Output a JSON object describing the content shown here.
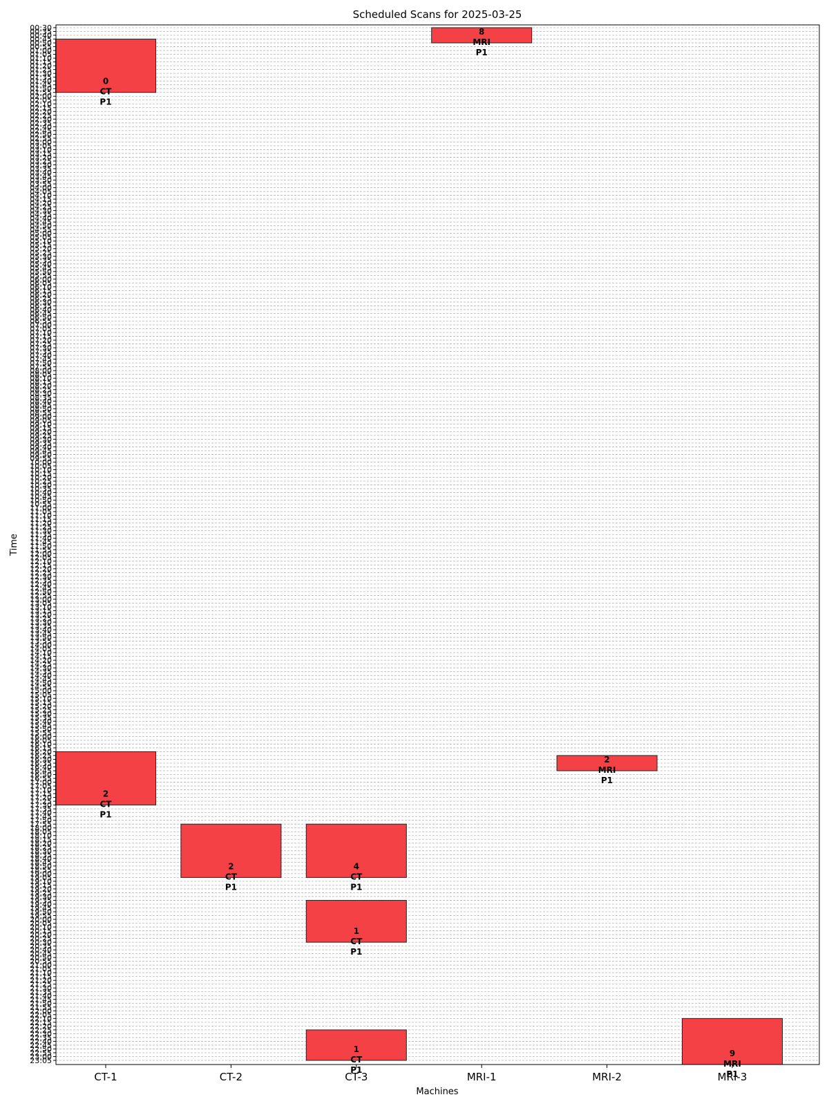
{
  "chart_data": {
    "type": "bar",
    "orientation": "gantt",
    "title": "Scheduled Scans for 2025-03-25",
    "xlabel": "Machines",
    "ylabel": "Time",
    "categories": [
      "CT-1",
      "CT-2",
      "CT-3",
      "MRI-1",
      "MRI-2",
      "MRI-3"
    ],
    "ylim": [
      "00:30",
      "23:05"
    ],
    "y_tick_step_minutes": 5,
    "y_inverted": true,
    "grid": "horizontal dashed",
    "bar_color": "#f44146",
    "scans": [
      {
        "machine": "CT-1",
        "start": "00:45",
        "end": "01:55",
        "label": [
          "0",
          "CT",
          "P1"
        ]
      },
      {
        "machine": "MRI-1",
        "start": "00:30",
        "end": "00:50",
        "label": [
          "8",
          "MRI",
          "P1"
        ]
      },
      {
        "machine": "CT-1",
        "start": "16:20",
        "end": "17:30",
        "label": [
          "2",
          "CT",
          "P1"
        ]
      },
      {
        "machine": "MRI-2",
        "start": "16:25",
        "end": "16:45",
        "label": [
          "2",
          "MRI",
          "P1"
        ]
      },
      {
        "machine": "CT-2",
        "start": "17:55",
        "end": "19:05",
        "label": [
          "2",
          "CT",
          "P1"
        ]
      },
      {
        "machine": "CT-3",
        "start": "17:55",
        "end": "19:05",
        "label": [
          "4",
          "CT",
          "P1"
        ]
      },
      {
        "machine": "CT-3",
        "start": "19:35",
        "end": "20:30",
        "label": [
          "1",
          "CT",
          "P1"
        ]
      },
      {
        "machine": "CT-3",
        "start": "22:25",
        "end": "23:05",
        "label": [
          "1",
          "CT",
          "P1"
        ]
      },
      {
        "machine": "MRI-3",
        "start": "22:10",
        "end": "23:15",
        "label": [
          "9",
          "MRI",
          "P1"
        ]
      }
    ]
  }
}
